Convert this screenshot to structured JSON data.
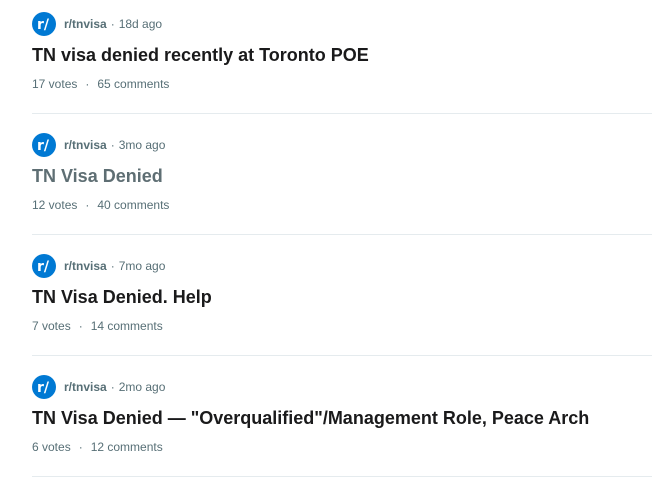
{
  "colors": {
    "accent": "#0079d3",
    "title": "#1a1a1b",
    "title_visited": "#5e6e73",
    "meta": "#576f76",
    "divider": "#e5ebee"
  },
  "icon": "reddit-subreddit-icon",
  "posts": [
    {
      "subreddit": "r/tnvisa",
      "separator": "·",
      "time": "18d ago",
      "title": "TN visa denied recently at Toronto POE",
      "votes": "17 votes",
      "dot": "·",
      "comments": "65 comments",
      "visited": false
    },
    {
      "subreddit": "r/tnvisa",
      "separator": "·",
      "time": "3mo ago",
      "title": "TN Visa Denied",
      "votes": "12 votes",
      "dot": "·",
      "comments": "40 comments",
      "visited": true
    },
    {
      "subreddit": "r/tnvisa",
      "separator": "·",
      "time": "7mo ago",
      "title": "TN Visa Denied. Help",
      "votes": "7 votes",
      "dot": "·",
      "comments": "14 comments",
      "visited": false
    },
    {
      "subreddit": "r/tnvisa",
      "separator": "·",
      "time": "2mo ago",
      "title": "TN Visa Denied — \"Overqualified\"/Management Role, Peace Arch",
      "votes": "6 votes",
      "dot": "·",
      "comments": "12 comments",
      "visited": false
    }
  ]
}
